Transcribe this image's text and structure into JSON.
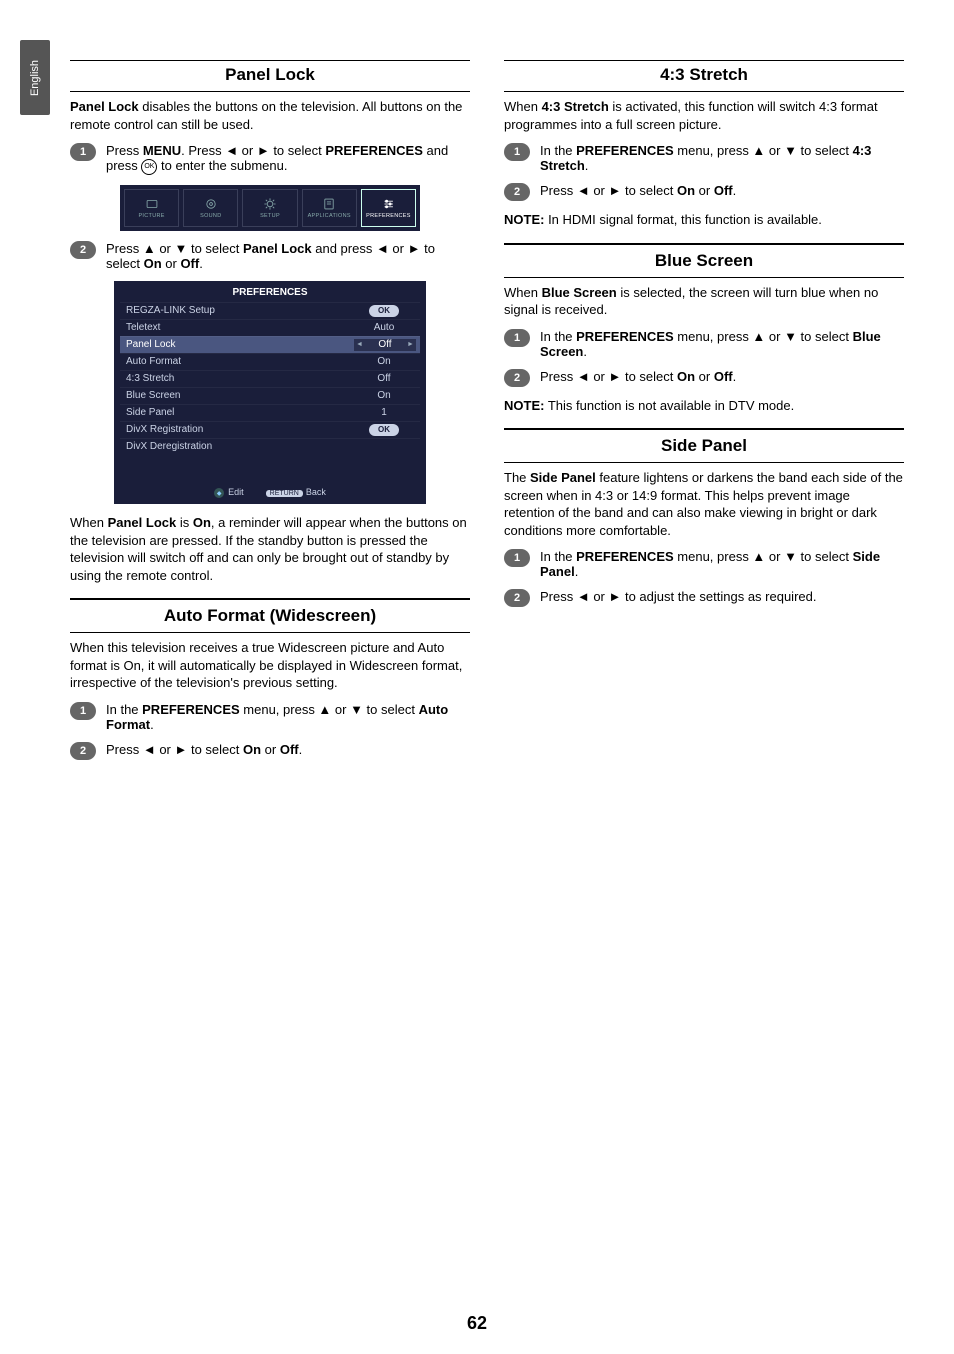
{
  "lang_tab": "English",
  "page_number": "62",
  "glyphs": {
    "left": "◄",
    "right": "►",
    "up": "▲",
    "down": "▼"
  },
  "sections": {
    "panel_lock": {
      "title": "Panel Lock",
      "intro_b": "Panel Lock",
      "intro_rest": " disables the buttons on the television. All buttons on the remote control can still be used.",
      "step1_a": "Press ",
      "step1_b1": "MENU",
      "step1_c": ". Press ◄ or ► to select ",
      "step1_b2": "PREFERENCES",
      "step1_d": " and press ",
      "step1_ok": "OK",
      "step1_e": " to enter the submenu.",
      "step2_a": "Press ▲ or ▼ to select ",
      "step2_b": "Panel Lock",
      "step2_c": " and press ◄ or ► to select ",
      "step2_on": "On",
      "step2_or": " or ",
      "step2_off": "Off",
      "step2_end": ".",
      "outro_a": "When ",
      "outro_b": "Panel Lock",
      "outro_c": " is ",
      "outro_on": "On",
      "outro_rest": ", a reminder will appear when the buttons on the television are pressed. If the standby button is pressed the television will switch off and can only be brought out of standby by using the remote control."
    },
    "auto_format": {
      "title": "Auto Format (Widescreen)",
      "intro": "When this television receives a true Widescreen picture and Auto format is On, it will automatically be displayed in Widescreen format, irrespective of the television's previous setting.",
      "step1_a": "In the ",
      "step1_b": "PREFERENCES",
      "step1_c": " menu, press ▲ or ▼ to select ",
      "step1_d": "Auto Format",
      "step1_e": ".",
      "step2_a": "Press ◄ or ► to select ",
      "step2_on": "On",
      "step2_or": " or ",
      "step2_off": "Off",
      "step2_end": "."
    },
    "stretch43": {
      "title": "4:3 Stretch",
      "intro_a": "When ",
      "intro_b": "4:3 Stretch",
      "intro_c": " is activated, this function will switch 4:3 format programmes into a full screen picture.",
      "step1_a": "In the ",
      "step1_b": "PREFERENCES",
      "step1_c": " menu, press ▲ or ▼ to select ",
      "step1_d": "4:3 Stretch",
      "step1_e": ".",
      "step2_a": "Press ◄ or ► to select ",
      "step2_on": "On",
      "step2_or": " or ",
      "step2_off": "Off",
      "step2_end": ".",
      "note_label": "NOTE:",
      "note_text": " In HDMI signal format, this function is available."
    },
    "blue_screen": {
      "title": "Blue Screen",
      "intro_a": "When ",
      "intro_b": "Blue Screen",
      "intro_c": " is selected, the screen will turn blue when no signal is received.",
      "step1_a": "In the ",
      "step1_b": "PREFERENCES",
      "step1_c": " menu, press ▲ or ▼ to select ",
      "step1_d": "Blue Screen",
      "step1_e": ".",
      "step2_a": "Press ◄ or ► to select ",
      "step2_on": "On",
      "step2_or": " or ",
      "step2_off": "Off",
      "step2_end": ".",
      "note_label": "NOTE:",
      "note_text": " This function is not available in DTV mode."
    },
    "side_panel": {
      "title": "Side Panel",
      "intro_a": "The ",
      "intro_b": "Side Panel",
      "intro_c": " feature lightens or darkens the band each side of the screen when in 4:3 or 14:9 format. This helps prevent image retention of the band and can also make viewing in bright or dark conditions more comfortable.",
      "step1_a": "In the ",
      "step1_b": "PREFERENCES",
      "step1_c": " menu, press ▲ or ▼ to select ",
      "step1_d": "Side Panel",
      "step1_e": ".",
      "step2": "Press ◄ or ► to adjust the settings as required."
    }
  },
  "menu_icons": {
    "items": [
      {
        "label": "PICTURE"
      },
      {
        "label": "SOUND"
      },
      {
        "label": "SETUP"
      },
      {
        "label": "APPLICATIONS"
      },
      {
        "label": "PREFERENCES"
      }
    ]
  },
  "pref_panel": {
    "title": "PREFERENCES",
    "rows": [
      {
        "name": "REGZA-LINK Setup",
        "value": "OK",
        "type": "ok"
      },
      {
        "name": "Teletext",
        "value": "Auto",
        "type": "text"
      },
      {
        "name": "Panel Lock",
        "value": "Off",
        "type": "selector",
        "highlight": true
      },
      {
        "name": "Auto Format",
        "value": "On",
        "type": "text"
      },
      {
        "name": "4:3 Stretch",
        "value": "Off",
        "type": "text"
      },
      {
        "name": "Blue Screen",
        "value": "On",
        "type": "text"
      },
      {
        "name": "Side Panel",
        "value": "1",
        "type": "text"
      },
      {
        "name": "DivX Registration",
        "value": "OK",
        "type": "ok"
      },
      {
        "name": "DivX Deregistration",
        "value": "",
        "type": "text"
      }
    ],
    "footer": {
      "edit": "Edit",
      "return_pill": "RETURN",
      "back": "Back"
    }
  }
}
